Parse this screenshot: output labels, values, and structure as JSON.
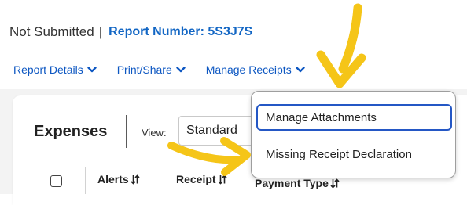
{
  "header": {
    "status": "Not Submitted",
    "separator": "|",
    "report_number": "Report Number: 5S3J7S"
  },
  "nav": {
    "items": [
      {
        "label": "Report Details",
        "icon": "chevron-down-icon"
      },
      {
        "label": "Print/Share",
        "icon": "chevron-down-icon"
      },
      {
        "label": "Manage Receipts",
        "icon": "chevron-down-icon"
      }
    ]
  },
  "expenses": {
    "title": "Expenses",
    "view_label": "View:",
    "view_value": "Standard"
  },
  "table": {
    "columns": [
      {
        "label": "Alerts",
        "icon": "sort-icon"
      },
      {
        "label": "Receipt",
        "icon": "sort-icon"
      },
      {
        "label": "Payment Type",
        "icon": "sort-icon"
      }
    ]
  },
  "dropdown": {
    "items": [
      {
        "label": "Manage Attachments"
      },
      {
        "label": "Missing Receipt Declaration"
      }
    ]
  },
  "colors": {
    "link": "#0d57c2",
    "report_number": "#1266c4",
    "focus_outline": "#2457c5",
    "annotation_arrow": "#f5c518"
  },
  "annotations": {
    "arrows": [
      "arrow-annotation-icon",
      "arrow-annotation-icon"
    ]
  }
}
